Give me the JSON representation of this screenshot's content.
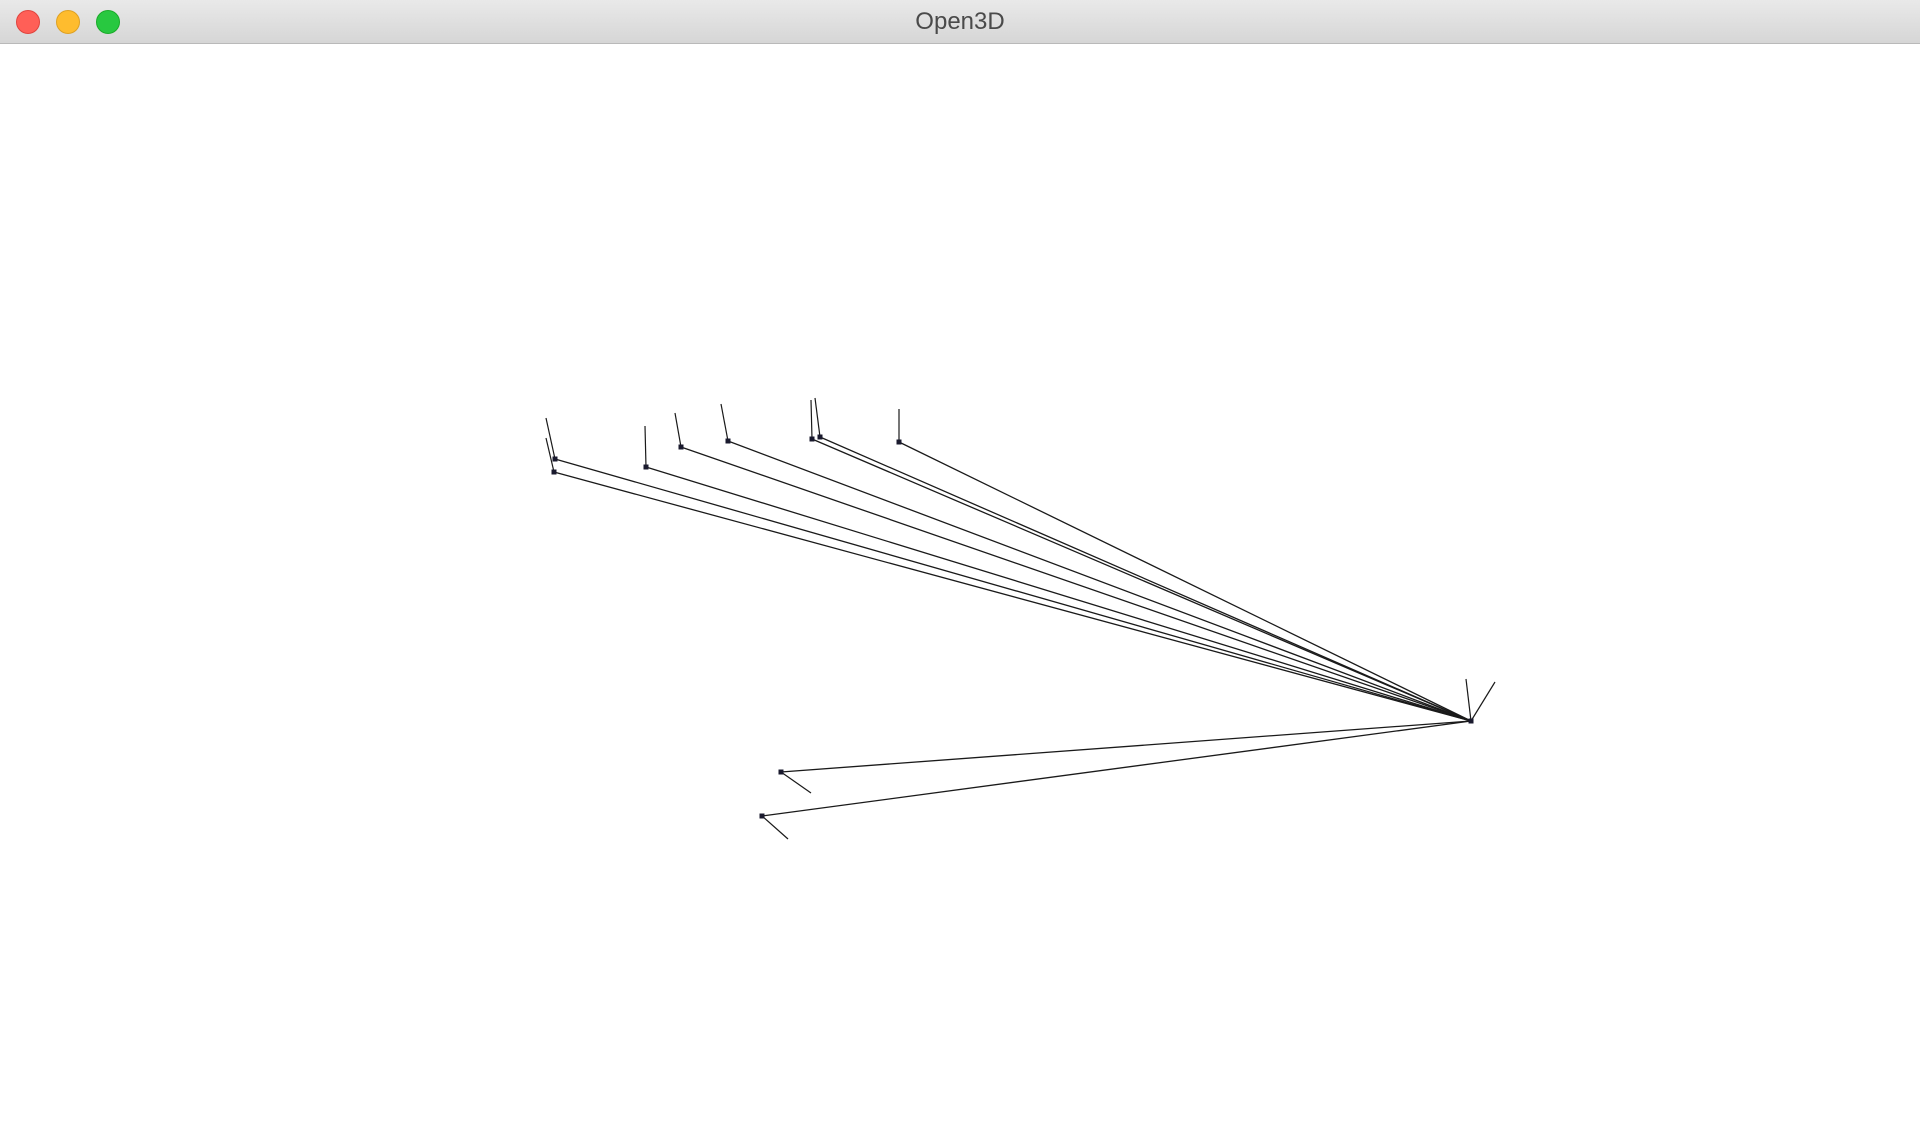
{
  "window": {
    "title": "Open3D",
    "buttons": {
      "close": "close-window",
      "minimize": "minimize-window",
      "zoom": "zoom-window"
    },
    "colors": {
      "close": "#ff5f57",
      "minimize": "#febc2e",
      "zoom": "#28c840",
      "background": "#ffffff",
      "lines": "#1a1a1a"
    }
  },
  "scene": {
    "type": "lineset",
    "description_visible": false,
    "hub_count": 1,
    "endpoint_count": 10
  }
}
